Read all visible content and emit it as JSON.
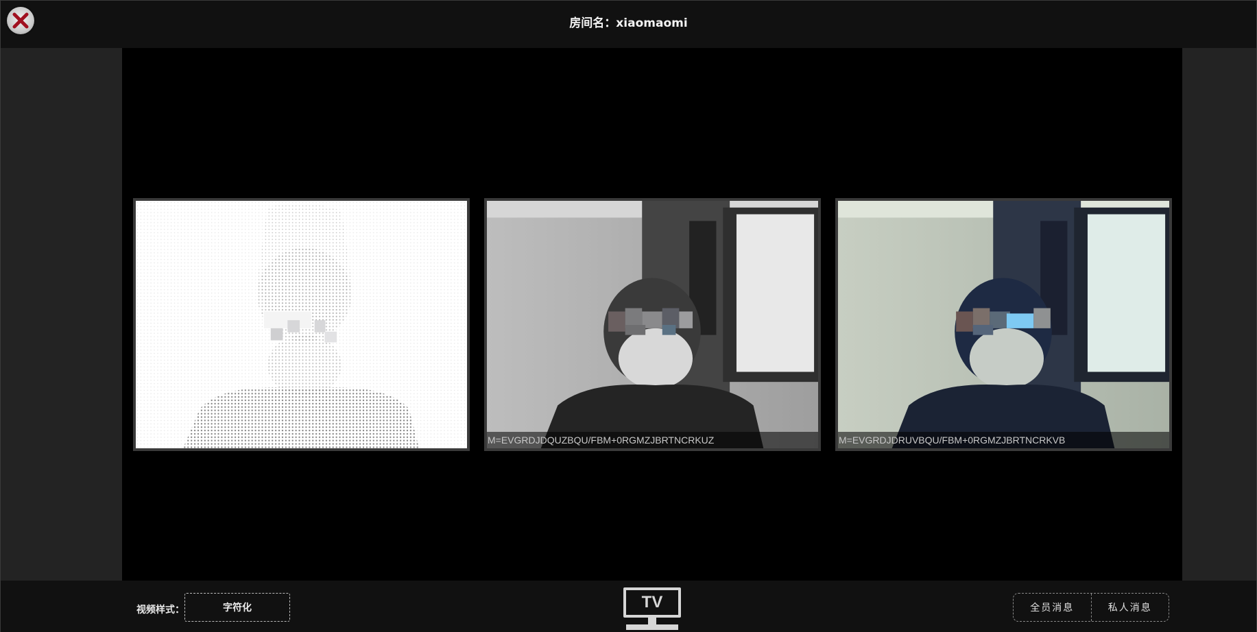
{
  "header": {
    "close_icon": "close-x-icon",
    "room_label": "房间名：xiaomaomi"
  },
  "tiles": [
    {
      "style": "ascii",
      "label": ""
    },
    {
      "style": "grayscale",
      "label": "M=EVGRDJDQUZBQU/FBM+0RGMZJBRTNCRKUZ"
    },
    {
      "style": "color",
      "label": "M=EVGRDJDRUVBQU/FBM+0RGMZJBRTNCRKVB"
    }
  ],
  "footer": {
    "video_style_label": "视频样式：",
    "video_style_value": "字符化",
    "tv_icon": "tv-icon",
    "tv_text": "TV",
    "all_messages_label": "全员消息",
    "private_messages_label": "私人消息"
  },
  "colors": {
    "page_bg": "#232323",
    "bar_bg": "#111111",
    "stage_bg": "#000000",
    "close_x": "#a01020"
  }
}
